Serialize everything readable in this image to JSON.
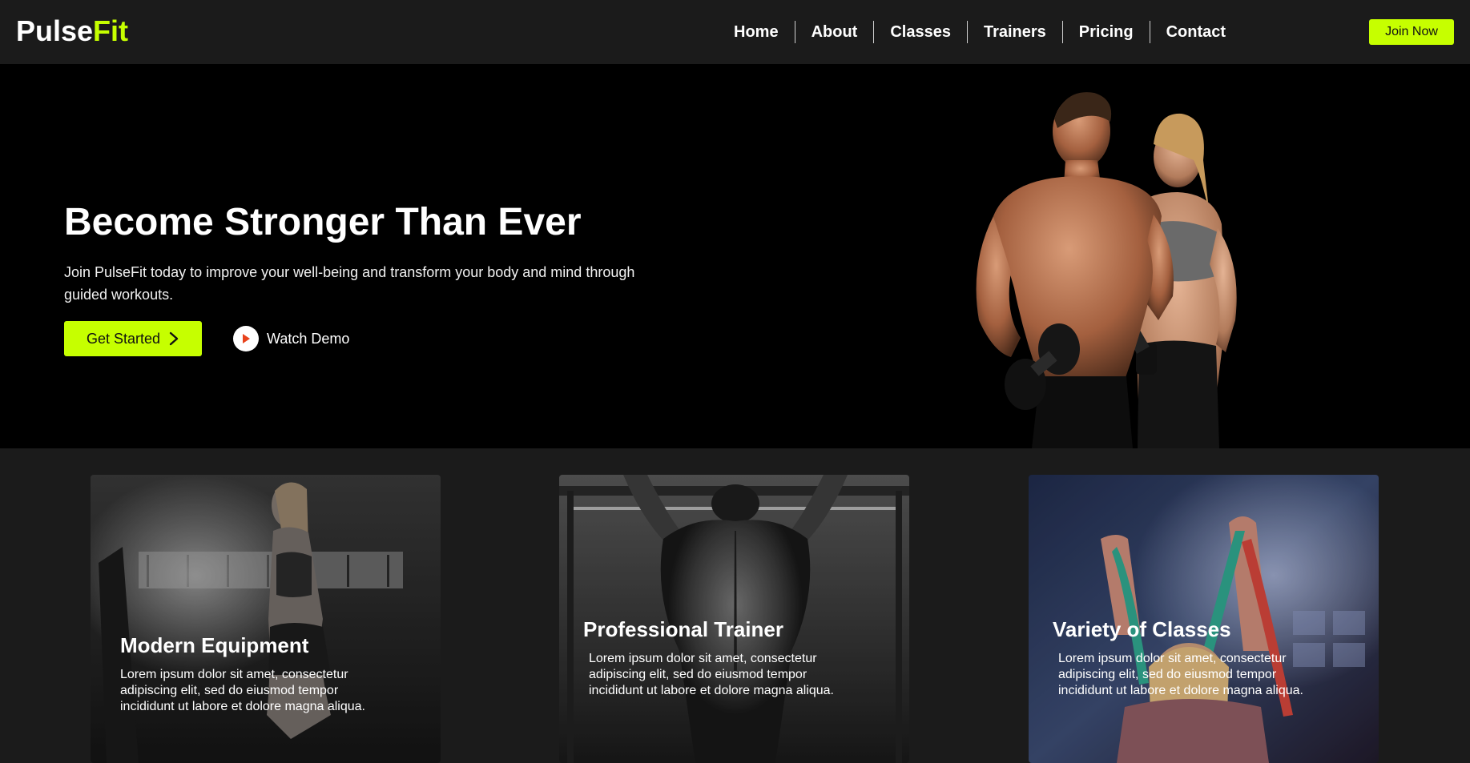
{
  "brand": {
    "part1": "Pulse",
    "part2": "Fit",
    "accent": "#c6ff00"
  },
  "nav": {
    "items": [
      {
        "label": "Home"
      },
      {
        "label": "About"
      },
      {
        "label": "Classes"
      },
      {
        "label": "Trainers"
      },
      {
        "label": "Pricing"
      },
      {
        "label": "Contact"
      }
    ],
    "join_label": "Join Now"
  },
  "hero": {
    "title": "Become Stronger Than Ever",
    "subtitle": "Join PulseFit today to improve your well-being and transform your body and mind through guided workouts.",
    "cta_label": "Get Started",
    "cta_icon": "chevron-right-icon",
    "demo_label": "Watch Demo",
    "demo_icon": "play-icon"
  },
  "features": [
    {
      "title": "Modern Equipment",
      "text": "Lorem ipsum dolor sit amet, consectetur adipiscing elit, sed do eiusmod tempor incididunt ut labore et dolore magna aliqua."
    },
    {
      "title": "Professional Trainer",
      "text": "Lorem ipsum dolor sit amet, consectetur adipiscing elit, sed do eiusmod tempor incididunt ut labore et dolore magna aliqua."
    },
    {
      "title": "Variety of Classes",
      "text": "Lorem ipsum dolor sit amet, consectetur adipiscing elit, sed do eiusmod tempor incididunt ut labore et dolore magna aliqua."
    }
  ]
}
